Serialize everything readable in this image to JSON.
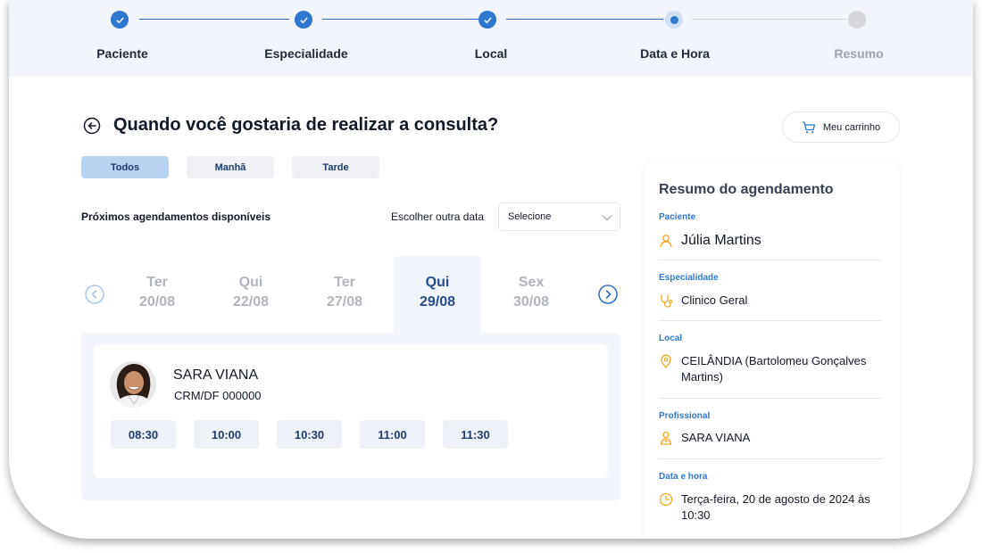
{
  "stepper": {
    "steps": [
      {
        "label": "Paciente",
        "state": "done"
      },
      {
        "label": "Especialidade",
        "state": "done"
      },
      {
        "label": "Local",
        "state": "done"
      },
      {
        "label": "Data e Hora",
        "state": "current"
      },
      {
        "label": "Resumo",
        "state": "pending"
      }
    ]
  },
  "header": {
    "title": "Quando você gostaria de realizar a consulta?",
    "cart_label": "Meu carrinho"
  },
  "filters": [
    {
      "label": "Todos",
      "active": true
    },
    {
      "label": "Manhã",
      "active": false
    },
    {
      "label": "Tarde",
      "active": false
    }
  ],
  "availability": {
    "label": "Próximos agendamentos disponíveis",
    "other_date_label": "Escolher outra data",
    "select_value": "Selecione"
  },
  "days": [
    {
      "weekday": "Ter",
      "date": "20/08",
      "selected": false
    },
    {
      "weekday": "Qui",
      "date": "22/08",
      "selected": false
    },
    {
      "weekday": "Ter",
      "date": "27/08",
      "selected": false
    },
    {
      "weekday": "Qui",
      "date": "29/08",
      "selected": true
    },
    {
      "weekday": "Sex",
      "date": "30/08",
      "selected": false
    }
  ],
  "doctor": {
    "name": "SARA VIANA",
    "crm": "CRM/DF 000000",
    "slots": [
      "08:30",
      "10:00",
      "10:30",
      "11:00",
      "11:30"
    ]
  },
  "summary": {
    "title": "Resumo do agendamento",
    "patient_label": "Paciente",
    "patient": "Júlia Martins",
    "specialty_label": "Especialidade",
    "specialty": "Clinico Geral",
    "location_label": "Local",
    "location": "CEILÂNDIA (Bartolomeu Gonçalves Martins)",
    "professional_label": "Profissional",
    "professional": "SARA VIANA",
    "datetime_label": "Data e hora",
    "datetime": "Terça-feira, 20 de agosto de 2024 às 10:30"
  },
  "colors": {
    "accent": "#2f78d0",
    "icon_orange": "#f5a623",
    "selected_bg": "#f2f5fb"
  }
}
